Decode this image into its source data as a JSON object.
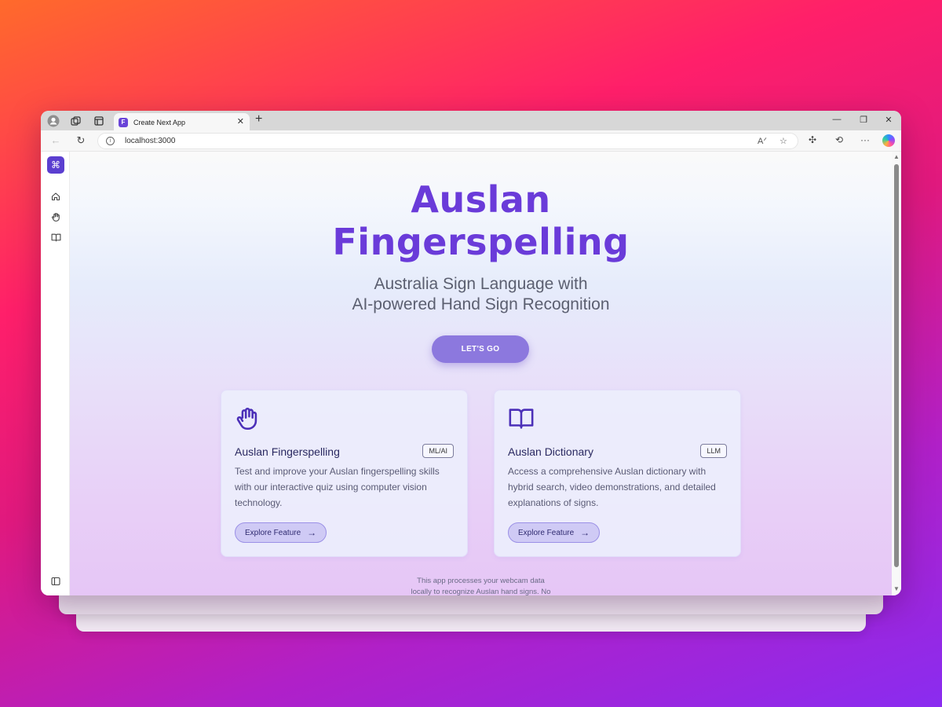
{
  "browser": {
    "tab_title": "Create Next App",
    "tab_favicon_letter": "F",
    "url": "localhost:3000",
    "icons": {
      "profile": "profile-icon",
      "workspaces": "workspaces-icon",
      "tab-actions": "tab-actions-icon",
      "new-tab": "plus-icon",
      "back": "back-arrow-icon",
      "refresh": "refresh-icon",
      "site-info": "info-icon",
      "read-aloud": "read-aloud-icon",
      "favorite": "star-icon",
      "extensions": "extensions-icon",
      "history": "history-icon",
      "more": "more-icon",
      "copilot": "copilot-icon"
    }
  },
  "sidebar": {
    "logo_glyph": "⌘",
    "items": [
      {
        "name": "home",
        "icon": "home-icon"
      },
      {
        "name": "fingerspelling",
        "icon": "hand-icon"
      },
      {
        "name": "dictionary",
        "icon": "book-icon"
      }
    ],
    "bottom_icon": "sidebar-toggle-icon"
  },
  "hero": {
    "title_line1": "Auslan",
    "title_line2": "Fingerspelling",
    "subtitle_line1": "Australia Sign Language with",
    "subtitle_line2": "AI-powered Hand Sign Recognition",
    "cta_label": "LET'S GO"
  },
  "cards": [
    {
      "icon": "hand-icon",
      "title": "Auslan Fingerspelling",
      "badge": "ML/AI",
      "description": "Test and improve your Auslan fingerspelling skills with our interactive quiz using computer vision technology.",
      "button_label": "Explore Feature"
    },
    {
      "icon": "book-icon",
      "title": "Auslan Dictionary",
      "badge": "LLM",
      "description": "Access a comprehensive Auslan dictionary with hybrid search, video demonstrations, and detailed explanations of signs.",
      "button_label": "Explore Feature"
    }
  ],
  "footer": {
    "line1": "This app processes your webcam data",
    "line2": "locally to recognize Auslan hand signs. No"
  },
  "colors": {
    "accent": "#6a3bd9",
    "cta": "#8c78de",
    "brand_logo": "#5b3fd0"
  }
}
